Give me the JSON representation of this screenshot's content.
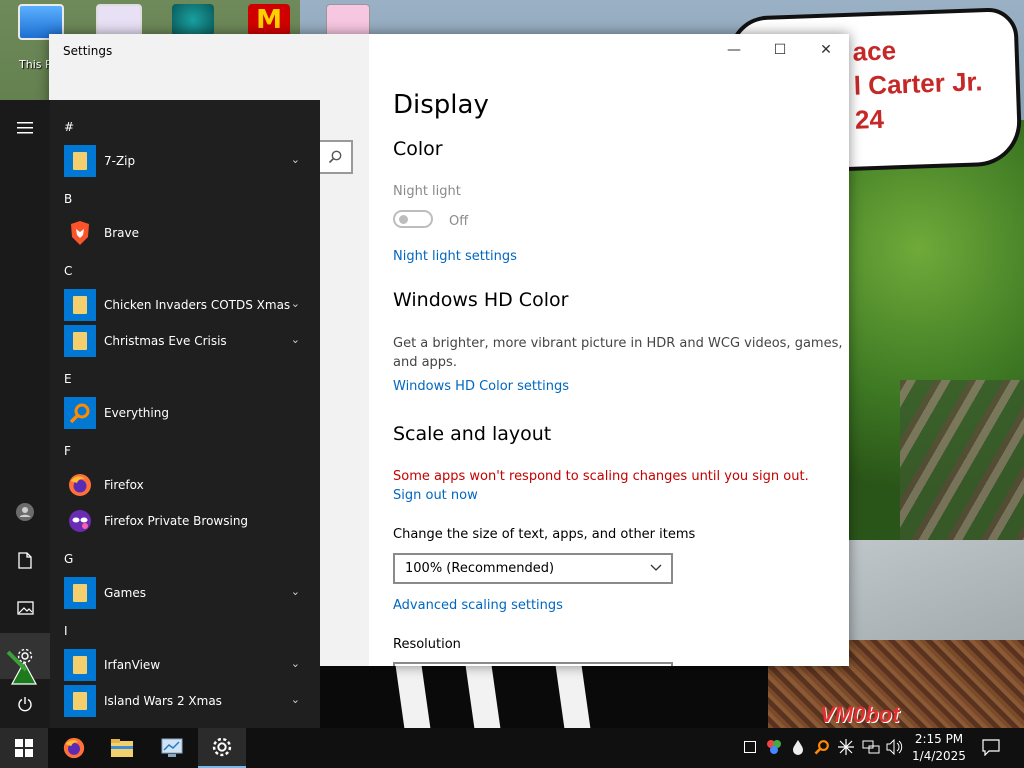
{
  "desktop": {
    "icon_label": "This P",
    "speech_lines": [
      "ace",
      "l Carter Jr.",
      "24"
    ],
    "watermark": "VM0bot"
  },
  "settings_window": {
    "title": "Settings",
    "buttons": {
      "minimize": "—",
      "maximize": "☐",
      "close": "✕"
    },
    "page_title": "Display",
    "color": {
      "heading": "Color",
      "night_light_label": "Night light",
      "toggle_state": "Off",
      "night_light_link": "Night light settings"
    },
    "hd_color": {
      "heading": "Windows HD Color",
      "description_line1": "Get a brighter, more vibrant picture in HDR and WCG videos, games,",
      "description_line2": "and apps.",
      "link": "Windows HD Color settings"
    },
    "scale": {
      "heading": "Scale and layout",
      "warning": "Some apps won't respond to scaling changes until you sign out.",
      "sign_out_link": "Sign out now",
      "size_label": "Change the size of text, apps, and other items",
      "size_value": "100% (Recommended)",
      "advanced_link": "Advanced scaling settings",
      "resolution_label": "Resolution"
    }
  },
  "start_menu": {
    "groups": [
      {
        "letter": "#",
        "apps": [
          {
            "name": "7-Zip",
            "icon": "folder-icon",
            "expandable": true
          }
        ]
      },
      {
        "letter": "B",
        "apps": [
          {
            "name": "Brave",
            "icon": "brave-icon",
            "expandable": false
          }
        ]
      },
      {
        "letter": "C",
        "apps": [
          {
            "name": "Chicken Invaders COTDS Xmas",
            "icon": "folder-icon",
            "expandable": true
          },
          {
            "name": "Christmas Eve Crisis",
            "icon": "folder-icon",
            "expandable": true
          }
        ]
      },
      {
        "letter": "E",
        "apps": [
          {
            "name": "Everything",
            "icon": "everything-search-icon",
            "expandable": false
          }
        ]
      },
      {
        "letter": "F",
        "apps": [
          {
            "name": "Firefox",
            "icon": "firefox-icon",
            "expandable": false
          },
          {
            "name": "Firefox Private Browsing",
            "icon": "firefox-private-icon",
            "expandable": false
          }
        ]
      },
      {
        "letter": "G",
        "apps": [
          {
            "name": "Games",
            "icon": "folder-icon",
            "expandable": true
          }
        ]
      },
      {
        "letter": "I",
        "apps": [
          {
            "name": "IrfanView",
            "icon": "folder-icon",
            "expandable": true
          },
          {
            "name": "Island Wars 2 Xmas",
            "icon": "folder-icon",
            "expandable": true
          }
        ]
      }
    ]
  },
  "taskbar": {
    "time": "2:15 PM",
    "date": "1/4/2025"
  },
  "colors": {
    "accent": "#0078d4",
    "link": "#0067c0",
    "warning": "#c50000",
    "start_bg": "#1f1f1f",
    "taskbar_bg": "#101010"
  }
}
